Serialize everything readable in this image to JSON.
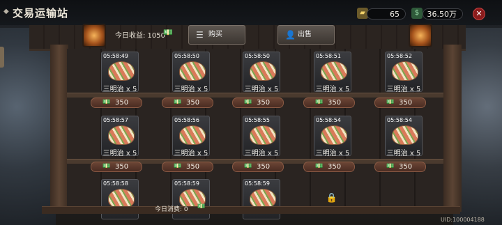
{
  "header": {
    "title": "交易运输站"
  },
  "resources": [
    {
      "icon": "gold-bar-icon",
      "value": "65"
    },
    {
      "icon": "cash-icon",
      "value": "36.50万"
    }
  ],
  "stall": {
    "income_label": "今日收益: 1050",
    "buy_label": "购买",
    "sell_label": "出售",
    "spent_label": "今日消费: 0",
    "uid": "UID:100004188"
  },
  "slots": [
    {
      "timer": "05:58:49",
      "item": "三明治 x 5",
      "price": "350"
    },
    {
      "timer": "05:58:50",
      "item": "三明治 x 5",
      "price": "350"
    },
    {
      "timer": "05:58:50",
      "item": "三明治 x 5",
      "price": "350"
    },
    {
      "timer": "05:58:51",
      "item": "三明治 x 5",
      "price": "350"
    },
    {
      "timer": "05:58:52",
      "item": "三明治 x 5",
      "price": "350"
    },
    {
      "timer": "05:58:57",
      "item": "三明治 x 5",
      "price": "350"
    },
    {
      "timer": "05:58:56",
      "item": "三明治 x 5",
      "price": "350"
    },
    {
      "timer": "05:58:55",
      "item": "三明治 x 5",
      "price": "350"
    },
    {
      "timer": "05:58:54",
      "item": "三明治 x 5",
      "price": "350"
    },
    {
      "timer": "05:58:54",
      "item": "三明治 x 5",
      "price": "350"
    },
    {
      "timer": "05:58:58",
      "item": "",
      "price": ""
    },
    {
      "timer": "05:58:59",
      "item": "",
      "price": ""
    },
    {
      "timer": "05:58:59",
      "item": "",
      "price": ""
    }
  ]
}
